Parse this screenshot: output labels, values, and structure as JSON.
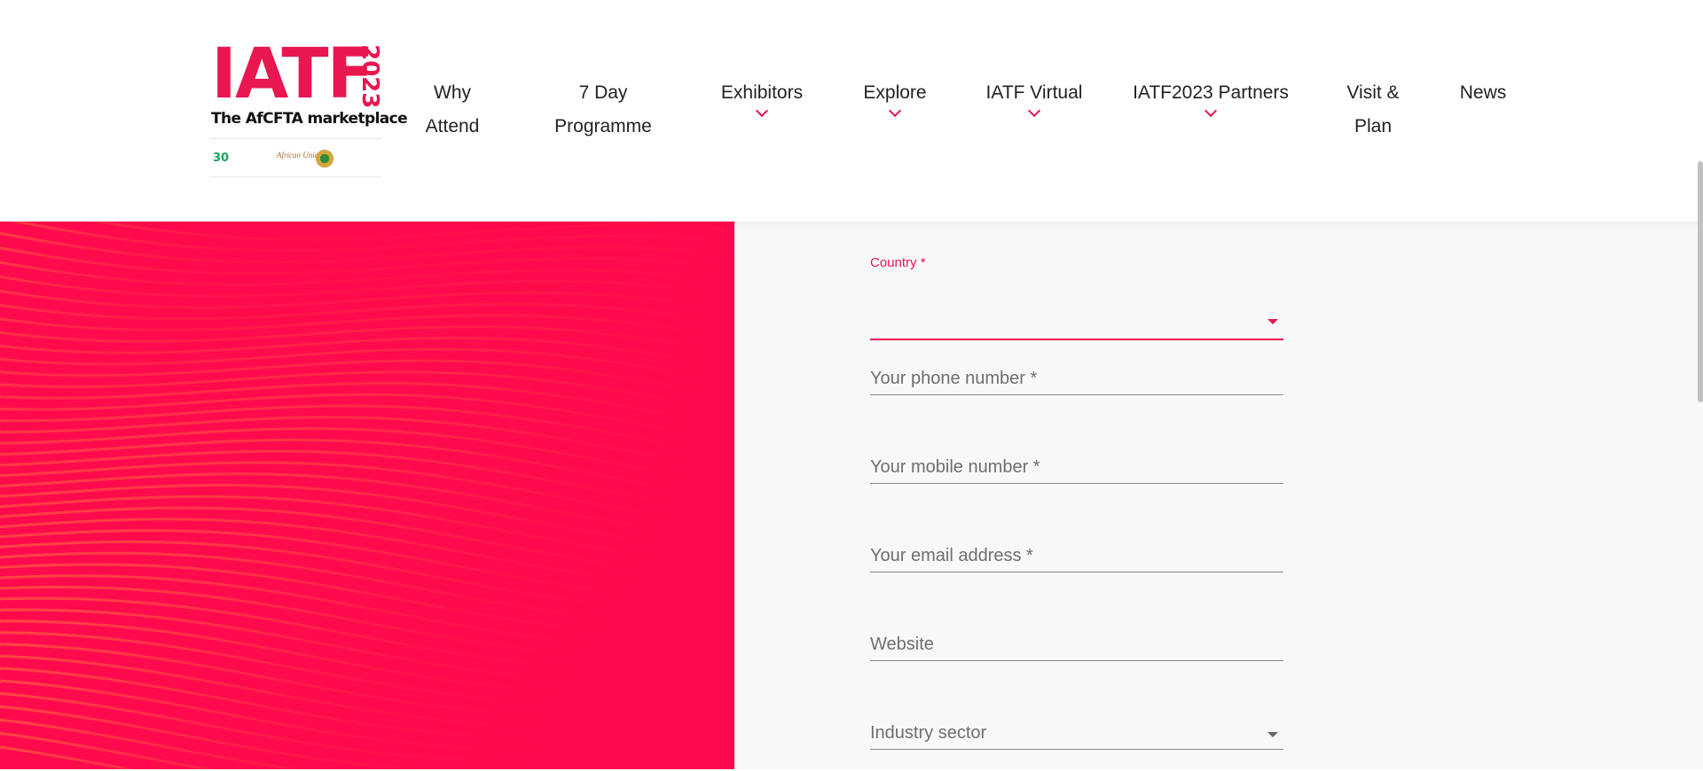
{
  "logo": {
    "name": "IATF",
    "year": "2023",
    "tagline": "The AfCFTA marketplace",
    "partner_mark": "30",
    "partner_au": "African Union"
  },
  "nav": {
    "items": [
      {
        "label": "Why Attend",
        "has_dropdown": false
      },
      {
        "label": "7 Day Programme",
        "has_dropdown": false
      },
      {
        "label": "Exhibitors",
        "has_dropdown": true
      },
      {
        "label": "Explore",
        "has_dropdown": true
      },
      {
        "label": "IATF Virtual",
        "has_dropdown": true
      },
      {
        "label": "IATF2023 Partners",
        "has_dropdown": true
      },
      {
        "label": "Visit & Plan",
        "has_dropdown": false
      },
      {
        "label": "News",
        "has_dropdown": false
      }
    ]
  },
  "form": {
    "country": {
      "label": "Country",
      "required_mark": "*",
      "value": ""
    },
    "phone": {
      "placeholder": "Your phone number *"
    },
    "mobile": {
      "placeholder": "Your mobile number *"
    },
    "email": {
      "placeholder": "Your email address *"
    },
    "website": {
      "placeholder": "Website"
    },
    "industry": {
      "placeholder": "Industry sector"
    }
  },
  "colors": {
    "accent": "#e8174f",
    "panel": "#ff0a4d",
    "form_bg": "#f8f8f8"
  }
}
